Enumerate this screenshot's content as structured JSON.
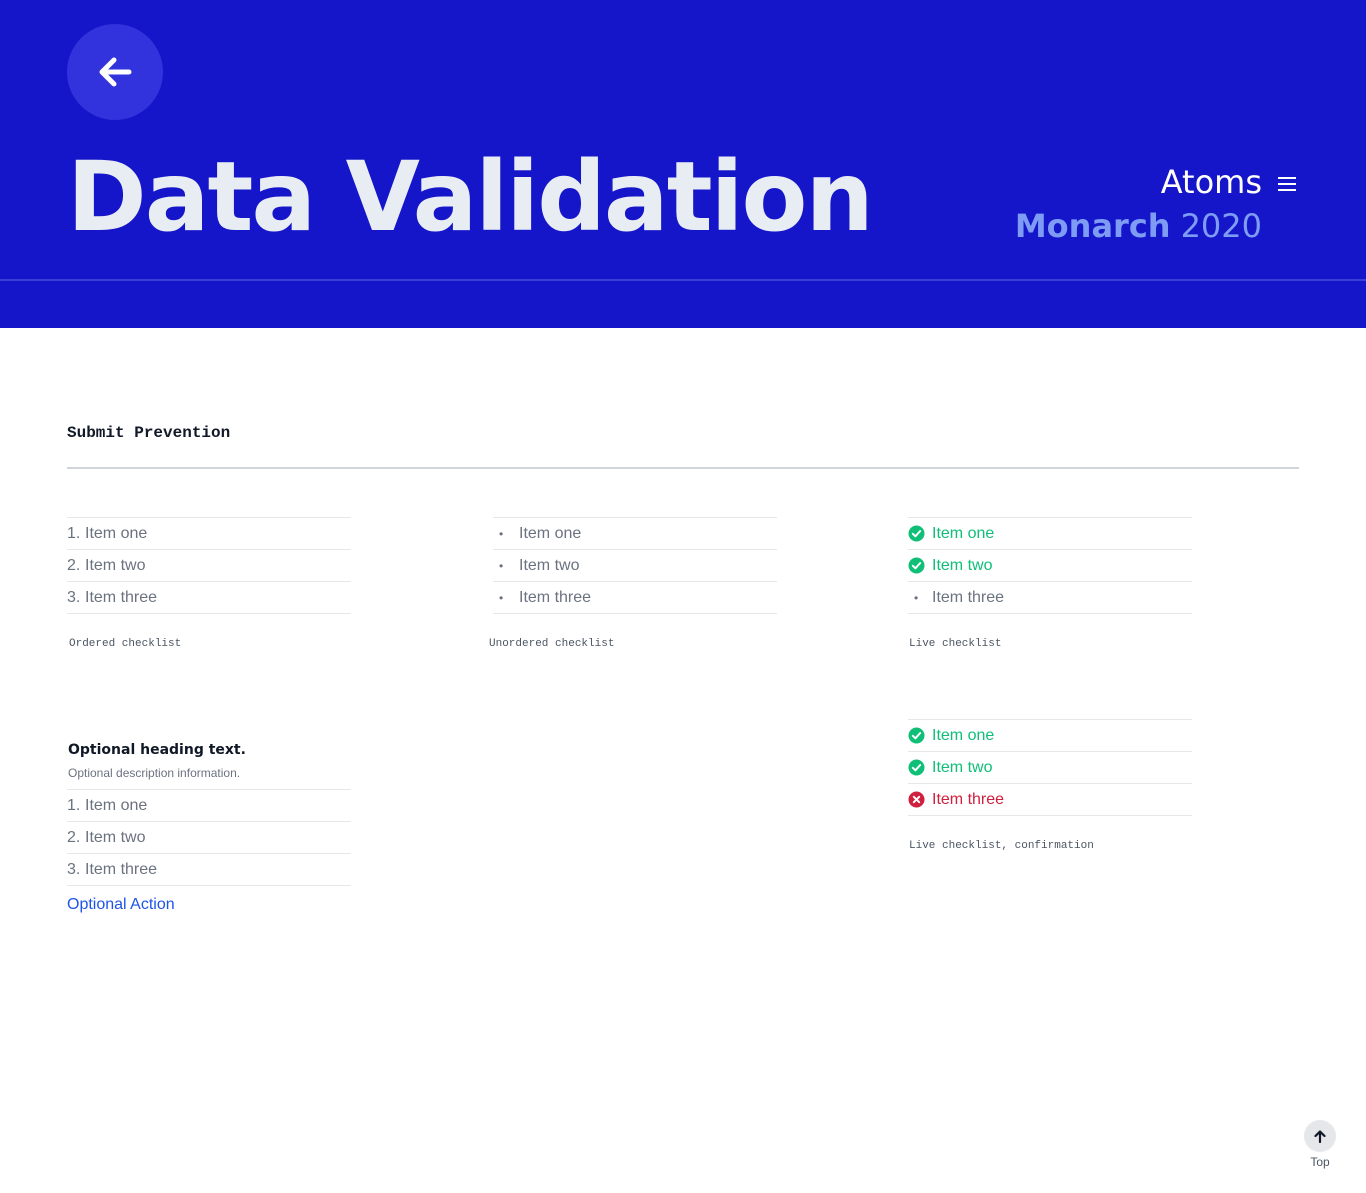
{
  "header": {
    "title": "Data Validation",
    "section": "Atoms",
    "brand_name": "Monarch",
    "brand_year": "2020",
    "background_color": "#1515c9"
  },
  "icons": {
    "back": "arrow-left-icon",
    "menu": "hamburger-menu-icon",
    "top": "arrow-up-icon",
    "check": "check-circle-icon",
    "error": "x-circle-icon"
  },
  "section": {
    "heading": "Submit Prevention"
  },
  "ordered_checklist": {
    "items": [
      {
        "num": "1.",
        "label": "Item one"
      },
      {
        "num": "2.",
        "label": "Item two"
      },
      {
        "num": "3.",
        "label": "Item three"
      }
    ],
    "caption": "Ordered checklist"
  },
  "unordered_checklist": {
    "items": [
      {
        "bullet": "•",
        "label": "Item one"
      },
      {
        "bullet": "•",
        "label": "Item two"
      },
      {
        "bullet": "•",
        "label": "Item three"
      }
    ],
    "caption": "Unordered checklist"
  },
  "live_checklist": {
    "items": [
      {
        "status": "valid",
        "label": "Item one"
      },
      {
        "status": "valid",
        "label": "Item two"
      },
      {
        "status": "pending",
        "bullet": "•",
        "label": "Item three"
      }
    ],
    "caption": "Live checklist"
  },
  "headed_checklist": {
    "heading": "Optional heading text.",
    "description": "Optional description information.",
    "items": [
      {
        "num": "1.",
        "label": "Item one"
      },
      {
        "num": "2.",
        "label": "Item two"
      },
      {
        "num": "3.",
        "label": "Item three"
      }
    ],
    "action": "Optional Action"
  },
  "confirmation_checklist": {
    "items": [
      {
        "status": "valid",
        "label": "Item one"
      },
      {
        "status": "valid",
        "label": "Item two"
      },
      {
        "status": "invalid",
        "label": "Item three"
      }
    ],
    "caption": "Live checklist, confirmation"
  },
  "colors": {
    "valid": "#0fbf77",
    "invalid": "#d0203f",
    "link": "#1d55e8"
  },
  "back_to_top": {
    "label": "Top"
  }
}
